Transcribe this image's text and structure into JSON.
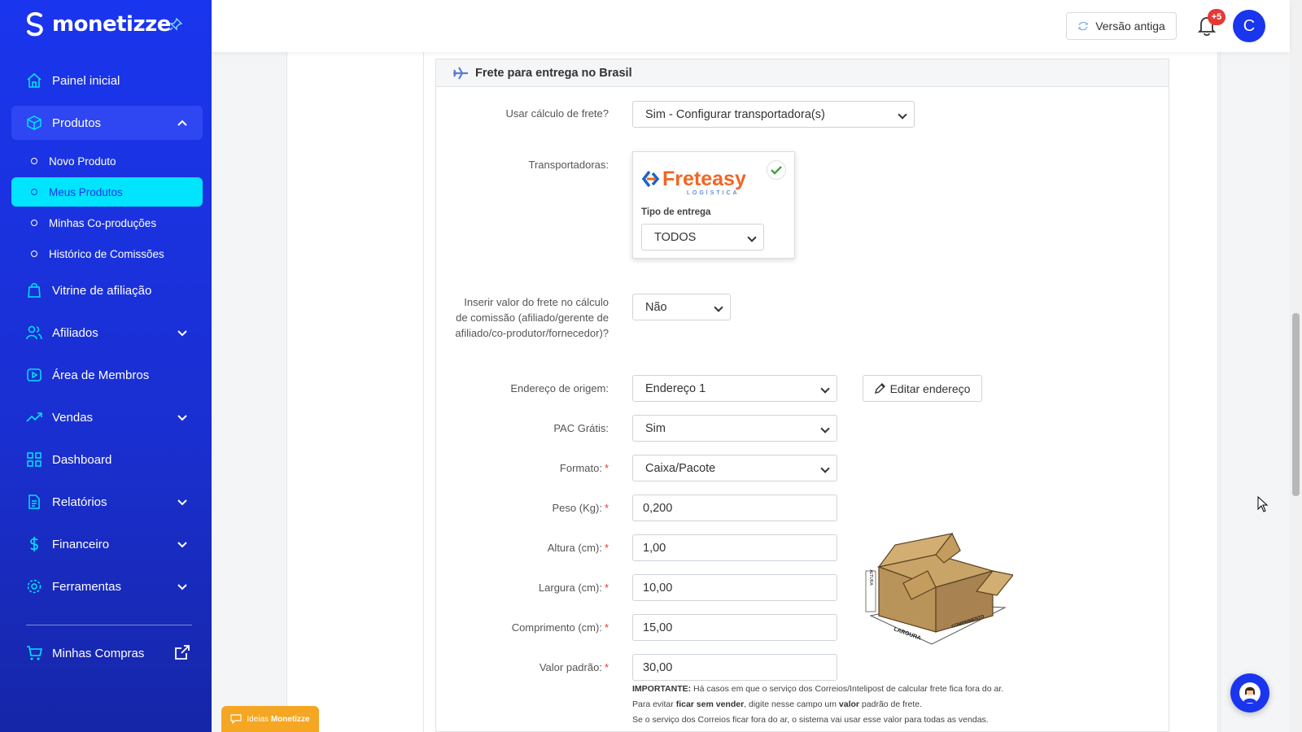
{
  "brand": {
    "name": "monetizze"
  },
  "sidebar": {
    "items": [
      {
        "label": "Painel inicial"
      },
      {
        "label": "Produtos"
      },
      {
        "label": "Vitrine de afiliação"
      },
      {
        "label": "Afiliados"
      },
      {
        "label": "Área de Membros"
      },
      {
        "label": "Vendas"
      },
      {
        "label": "Dashboard"
      },
      {
        "label": "Relatórios"
      },
      {
        "label": "Financeiro"
      },
      {
        "label": "Ferramentas"
      }
    ],
    "sub_items": [
      {
        "label": "Novo Produto"
      },
      {
        "label": "Meus Produtos"
      },
      {
        "label": "Minhas Co-produções"
      },
      {
        "label": "Histórico de Comissões"
      }
    ],
    "compras": "Minhas Compras"
  },
  "topbar": {
    "old_version": "Versão antiga",
    "notif_badge": "+5",
    "avatar_initial": "C"
  },
  "section": {
    "title": "Frete para entrega no Brasil"
  },
  "form": {
    "usar_calculo": {
      "label": "Usar cálculo de frete?",
      "value": "Sim - Configurar transportadora(s)"
    },
    "transportadoras": {
      "label": "Transportadoras:",
      "tipo_label": "Tipo de entrega",
      "tipo_value": "TODOS",
      "carrier_name": "Freteasy",
      "carrier_sub": "LOGÍSTICA"
    },
    "inserir": {
      "label": "Inserir valor do frete no cálculo de comissão (afiliado/gerente de afiliado/co-produtor/fornecedor)?",
      "value": "Não"
    },
    "endereco": {
      "label": "Endereço de origem:",
      "value": "Endereço 1",
      "edit_button": "Editar endereço"
    },
    "pac": {
      "label": "PAC Grátis:",
      "value": "Sim"
    },
    "formato": {
      "label": "Formato:",
      "value": "Caixa/Pacote"
    },
    "peso": {
      "label": "Peso (Kg):",
      "value": "0,200"
    },
    "altura": {
      "label": "Altura (cm):",
      "value": "1,00"
    },
    "largura": {
      "label": "Largura (cm):",
      "value": "10,00"
    },
    "comprimento": {
      "label": "Comprimento (cm):",
      "value": "15,00"
    },
    "valor": {
      "label": "Valor padrão:",
      "value": "30,00"
    },
    "required_mark": "*"
  },
  "box_labels": {
    "altura": "ALTURA",
    "largura": "LARGURA",
    "comprimento": "COMPRIMENTO"
  },
  "note": {
    "line1_bold": "IMPORTANTE:",
    "line1_rest": " Há casos em que o serviço dos Correios/Intelipost de calcular frete fica fora do ar.",
    "line2_a": "Para evitar ",
    "line2_b": "ficar sem vender",
    "line2_c": ", digite nesse campo um ",
    "line2_d": "valor",
    "line2_e": " padrão de frete.",
    "line3": "Se o serviço dos Correios ficar fora do ar, o sistema vai usar esse valor para todas as vendas."
  },
  "ideas": {
    "prefix": "Ideias",
    "brand": "Monetizze"
  },
  "colors": {
    "sidebar": "#1a35ee",
    "active": "#00e5ff",
    "badge": "#e53935",
    "ideas": "#f5a623"
  }
}
